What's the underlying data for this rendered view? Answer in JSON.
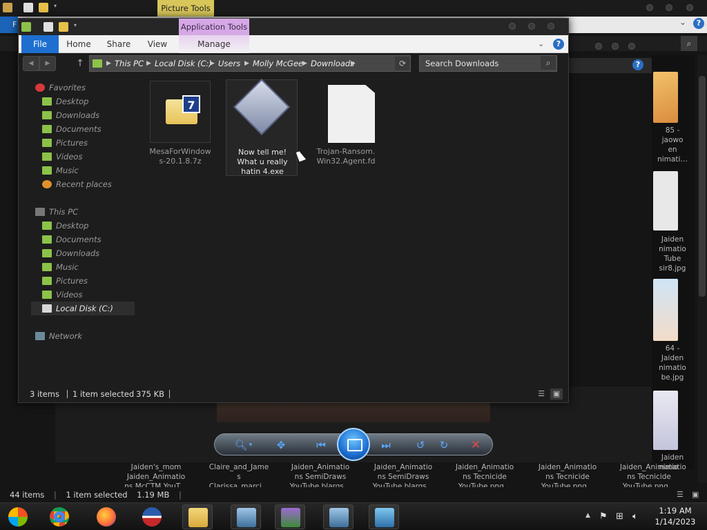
{
  "background_window": {
    "context_tab": "Picture Tools",
    "file_tab": "F",
    "status": {
      "items": "44 items",
      "selected": "1 item selected",
      "size": "1.19 MB"
    },
    "right_pane_captions": [
      "85 -\njaowo\nen\nnimati…",
      "Jaiden\nnimatio\nTube\nsir8.jpg",
      "64 -\nJaiden\nnimatio\nbe.jpg",
      "Jaiden\nnimatio"
    ],
    "bottom_captions": [
      "Jaiden's_mom\nJaiden_Animatio\nns McCTM YouT…",
      "Claire_and_Jame\ns\nClarissa_marci…",
      "Jaiden_Animatio\nns SemiDraws\nYouTube blargs…",
      "Jaiden_Animatio\nns SemiDraws\nYouTube blargs…",
      "Jaiden_Animatio\nns Tecnicide\nYouTube.png…",
      "Jaiden_Animatio\nns Tecnicide\nYouTube.png…",
      "Jaiden_Animatio\nns Tecnicide\nYouTube.png…"
    ]
  },
  "window": {
    "context_tab": "Application Tools",
    "ribbon_tabs": {
      "file": "File",
      "home": "Home",
      "share": "Share",
      "view": "View",
      "manage": "Manage"
    },
    "help": "?",
    "breadcrumb": [
      "This PC",
      "Local Disk (C:)",
      "Users",
      "Molly McGee",
      "Downloads"
    ],
    "search_placeholder": "Search Downloads",
    "nav": {
      "favorites": {
        "label": "Favorites",
        "items": [
          "Desktop",
          "Downloads",
          "Documents",
          "Pictures",
          "Videos",
          "Music",
          "Recent places"
        ]
      },
      "this_pc": {
        "label": "This PC",
        "items": [
          "Desktop",
          "Documents",
          "Downloads",
          "Music",
          "Pictures",
          "Videos",
          "Local Disk (C:)"
        ]
      },
      "network": "Network"
    },
    "files": [
      {
        "name": "MesaForWindow\ns-20.1.8.7z",
        "badge": "7"
      },
      {
        "name": "Now tell me!\nWhat u really\nhatin 4.exe"
      },
      {
        "name": "Trojan-Ransom.\nWin32.Agent.fd"
      }
    ],
    "status": {
      "items": "3 items",
      "selected": "1 item selected",
      "size": "375 KB"
    }
  },
  "taskbar": {
    "clock_time": "1:19 AM",
    "clock_date": "1/14/2023"
  },
  "colors": {
    "file_tab": "#1e6fd0",
    "application_tools": "#d6a8e6",
    "picture_tools": "#d8c65a",
    "folder_green": "#8cc24a"
  }
}
